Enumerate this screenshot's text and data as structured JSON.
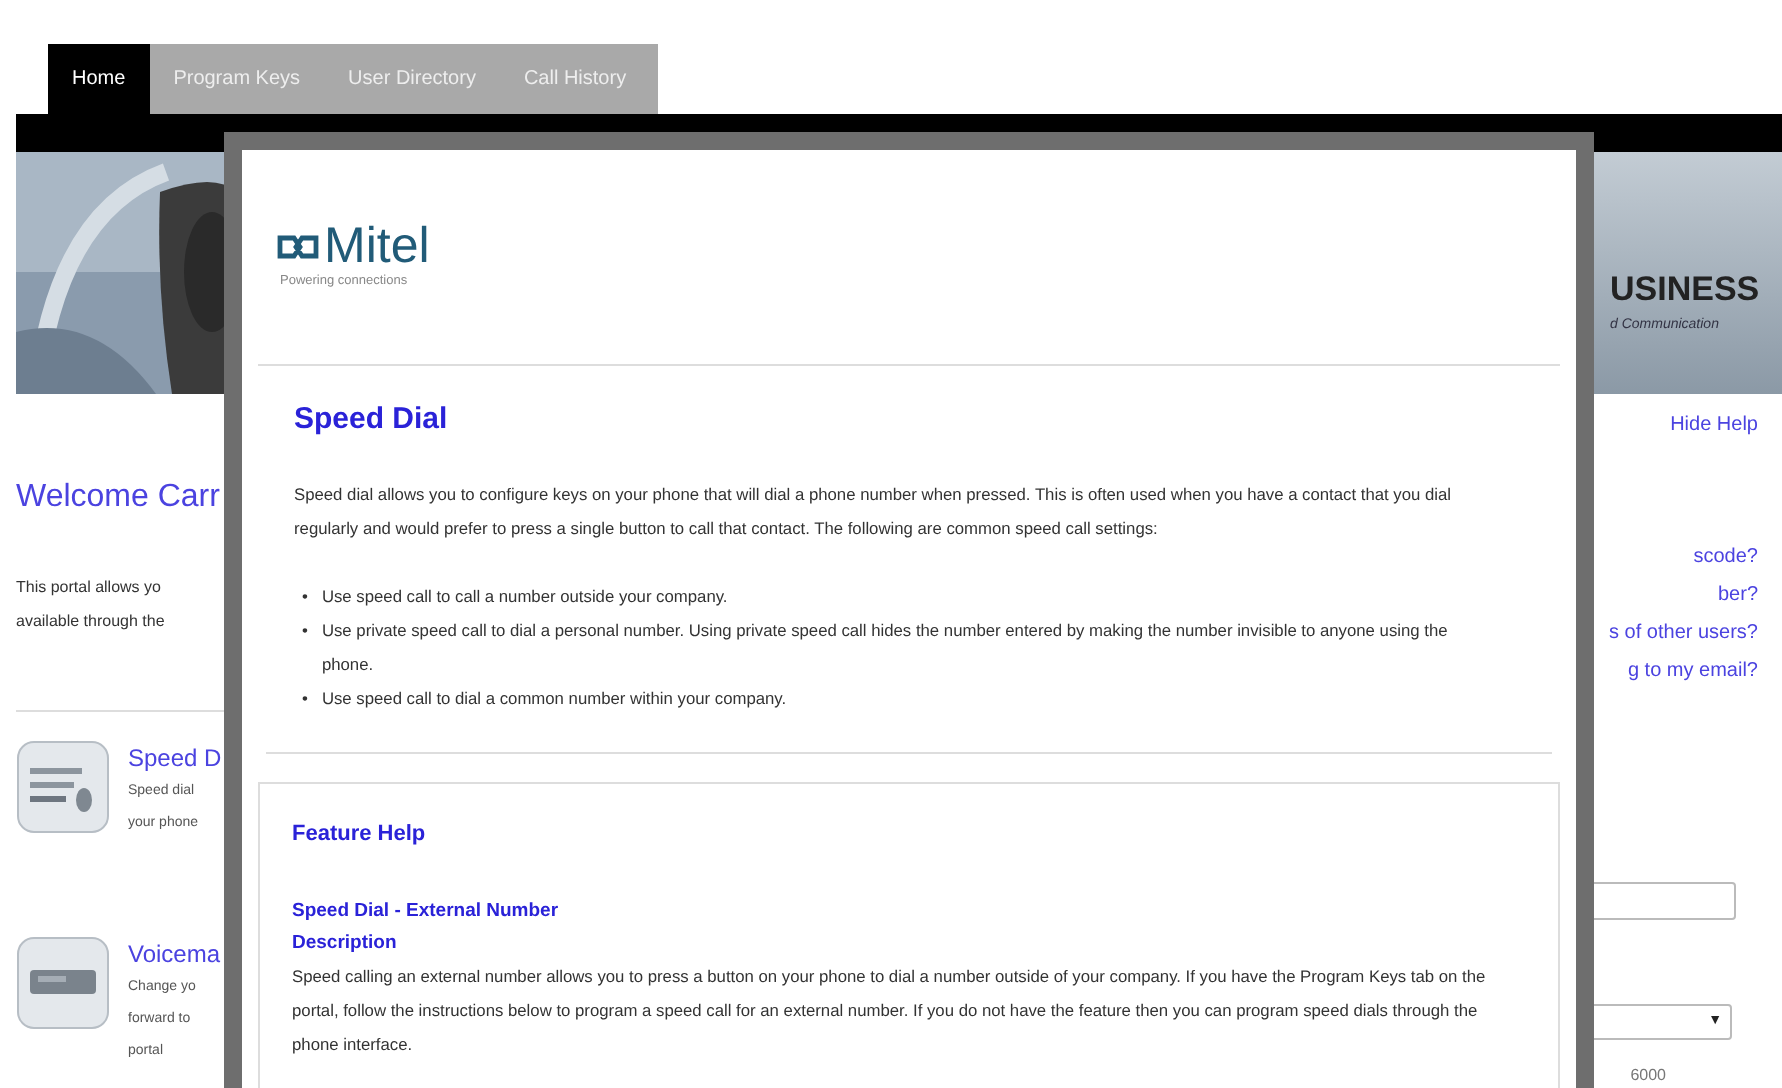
{
  "tabs": [
    {
      "label": "Home",
      "selected": true
    },
    {
      "label": "Program Keys",
      "selected": false
    },
    {
      "label": "User Directory",
      "selected": false
    },
    {
      "label": "Call History",
      "selected": false
    }
  ],
  "banner": {
    "brand": "USINESS",
    "tagline": "d Communication"
  },
  "welcome": {
    "title": "Welcome Carr",
    "intro_lines": [
      "This portal allows yo",
      "available through the"
    ]
  },
  "features": [
    {
      "kind": "keypad",
      "title": "Speed D",
      "lines": [
        "Speed dial",
        "your phone"
      ]
    },
    {
      "kind": "device",
      "title": "Voicema",
      "lines": [
        "Change yo",
        "forward to",
        "portal"
      ]
    }
  ],
  "help_toggle": "Hide Help",
  "help_links": [
    "scode?",
    "ber?",
    "s of other users?",
    "g to my email?"
  ],
  "form": {
    "select_arrow": "▼",
    "number": "6000"
  },
  "modal": {
    "logo": {
      "name": "Mitel",
      "tagline": "Powering connections"
    },
    "title": "Speed Dial",
    "intro": "Speed dial allows you to configure keys on your phone that will dial a phone number when pressed. This is often used when you have a contact that you dial regularly and would prefer to press a single button to call that contact. The following are common speed call settings:",
    "bullets": [
      {
        "marker": "•",
        "text": "Use speed call to call a number outside your company."
      },
      {
        "marker": "•",
        "text": "Use private speed call to dial a personal number. Using private speed call hides the number entered by making the number invisible to anyone using the phone."
      },
      {
        "marker": "•",
        "text": "Use speed call to dial a common number within your company."
      }
    ],
    "feature_help": {
      "legend": "Feature Help",
      "topic": "Speed Dial - External Number",
      "heading": "Description",
      "text": "Speed calling an external number allows you to press a button on your phone to dial a number outside of your company. If you have the Program Keys tab on the portal, follow the instructions below to program a speed call for an external number. If you do not have the feature then you can program speed dials through the phone interface."
    }
  }
}
